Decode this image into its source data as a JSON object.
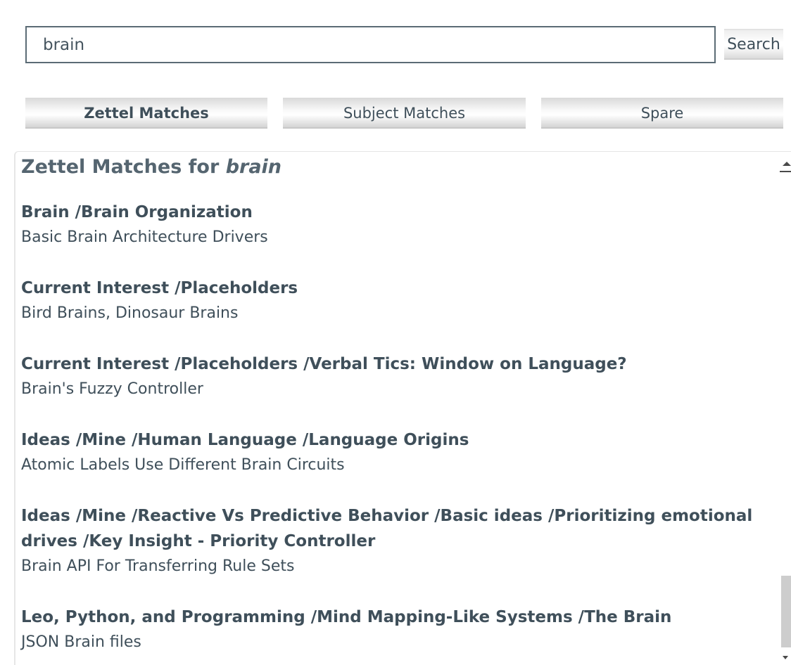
{
  "search": {
    "value": "brain",
    "button_label": "Search"
  },
  "tabs": [
    {
      "label": "Zettel Matches",
      "active": true
    },
    {
      "label": "Subject Matches",
      "active": false
    },
    {
      "label": "Spare",
      "active": false
    }
  ],
  "results": {
    "heading_prefix": "Zettel Matches for ",
    "heading_term": "brain",
    "items": [
      {
        "path": "Brain /Brain Organization",
        "title": "Basic Brain Architecture Drivers"
      },
      {
        "path": "Current Interest /Placeholders",
        "title": "Bird Brains, Dinosaur Brains"
      },
      {
        "path": "Current Interest /Placeholders /Verbal Tics: Window on Language?",
        "title": "Brain's Fuzzy Controller"
      },
      {
        "path": "Ideas /Mine /Human Language /Language Origins",
        "title": "Atomic Labels Use Different Brain Circuits"
      },
      {
        "path": "Ideas /Mine /Reactive Vs Predictive Behavior /Basic ideas /Prioritizing emotional drives /Key Insight - Priority Controller",
        "title": "Brain API For Transferring Rule Sets"
      },
      {
        "path": "Leo, Python, and Programming /Mind Mapping-Like Systems /The Brain",
        "title": "JSON Brain files"
      }
    ]
  },
  "colors": {
    "text": "#3f4f5a",
    "heading": "#556570",
    "input_border": "#5b6b75",
    "scroll_thumb": "#cdcdcd"
  }
}
